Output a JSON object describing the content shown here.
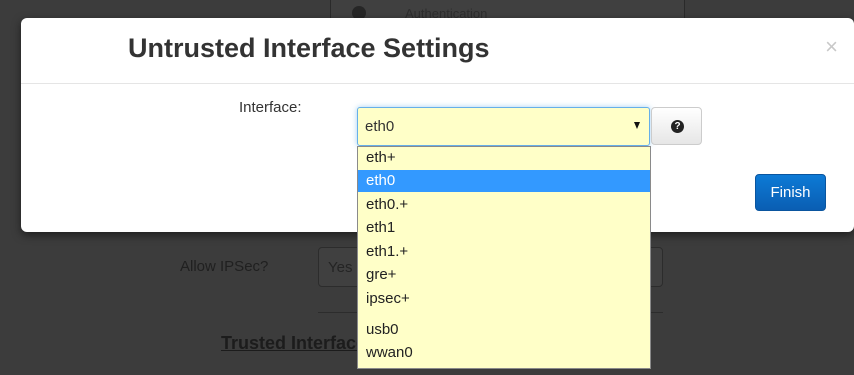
{
  "background": {
    "top_cell_text": "Authentication",
    "allow_ipsec_label": "Allow IPSec?",
    "allow_ipsec_value": "Yes",
    "trusted_heading": "Trusted Interface Settings"
  },
  "modal": {
    "title": "Untrusted Interface Settings",
    "close_glyph": "×",
    "interface_label": "Interface:",
    "selected_value": "eth0",
    "help_glyph": "?",
    "finish_label": "Finish"
  },
  "dropdown": {
    "options": [
      "eth+",
      "eth0",
      "eth0.+",
      "eth1",
      "eth1.+",
      "gre+",
      "ipsec+",
      "usb0",
      "wwan0"
    ],
    "highlighted": "eth0"
  },
  "colors": {
    "select_bg": "#ffffc8",
    "highlight": "#3399ff",
    "finish_button": "#0a6ac4",
    "overlay": "#3c3c3c"
  }
}
